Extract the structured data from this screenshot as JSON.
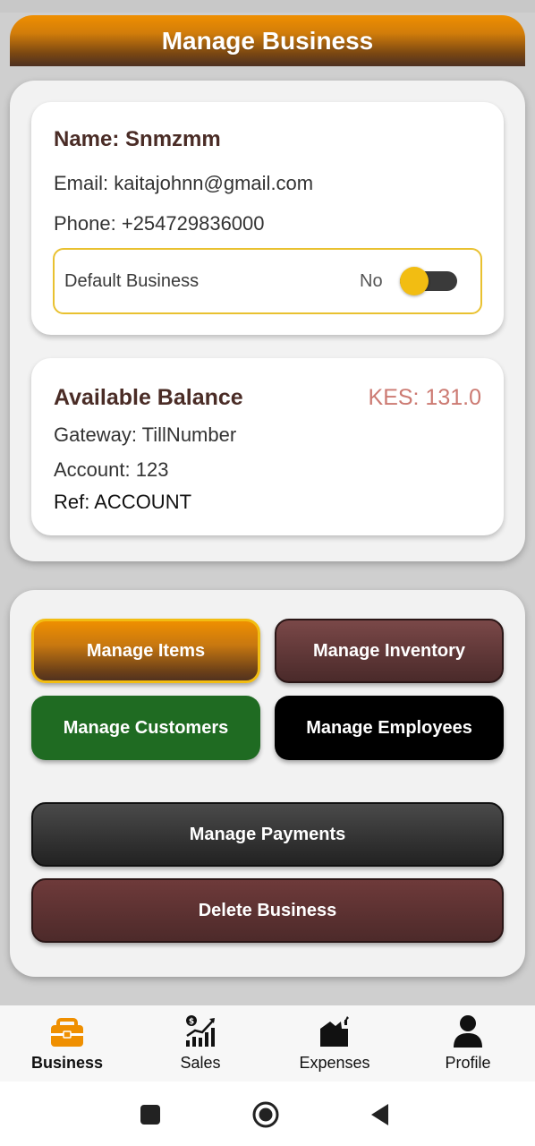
{
  "header": {
    "title": "Manage Business"
  },
  "business": {
    "name": "Name: Snmzmm",
    "email": "Email: kaitajohnn@gmail.com",
    "phone": "Phone: +254729836000",
    "default_label": "Default Business",
    "default_value": "No",
    "default_toggle_on": false
  },
  "balance": {
    "title": "Available Balance",
    "amount": "KES: 131.0",
    "gateway": "Gateway: TillNumber",
    "account": "Account: 123",
    "ref": "Ref: ACCOUNT"
  },
  "actions": {
    "manage_items": "Manage Items",
    "manage_inventory": "Manage Inventory",
    "manage_customers": "Manage Customers",
    "manage_employees": "Manage Employees",
    "manage_payments": "Manage Payments",
    "delete_business": "Delete Business"
  },
  "colors": {
    "accent_orange": "#ef8f00",
    "brown": "#4a2c26",
    "toggle_yellow": "#f2bd12",
    "green": "#1f6b22",
    "balance_amount": "#cc7a72"
  },
  "bottom_nav": {
    "active": "business",
    "items": [
      {
        "key": "business",
        "label": "Business",
        "icon": "briefcase-icon"
      },
      {
        "key": "sales",
        "label": "Sales",
        "icon": "sales-chart-icon"
      },
      {
        "key": "expenses",
        "label": "Expenses",
        "icon": "expenses-icon"
      },
      {
        "key": "profile",
        "label": "Profile",
        "icon": "person-icon"
      }
    ]
  },
  "system_nav": {
    "icons": [
      "recent-apps-icon",
      "home-icon",
      "back-icon"
    ]
  }
}
